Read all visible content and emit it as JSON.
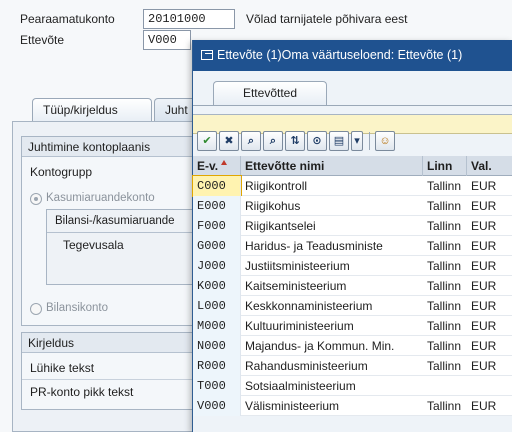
{
  "background": {
    "fields": [
      {
        "label": "Pearaamatukonto",
        "value": "20101000",
        "description": "Võlad tarnijatele põhivara eest"
      },
      {
        "label": "Ettevõte",
        "value": "V000"
      }
    ],
    "tabs": [
      {
        "label": "Tüüp/kirjeldus"
      },
      {
        "label": "Juht"
      }
    ],
    "group_control": {
      "title": "Juhtimine kontoplaanis",
      "kontogrupp_label": "Kontogrupp",
      "radio_income": "Kasumiaruandekonto",
      "inner_title": "Bilansi-/kasumiaruande",
      "tegevusala_label": "Tegevusala",
      "radio_balance": "Bilansikonto"
    },
    "group_description": {
      "title": "Kirjeldus",
      "short_label": "Lühike tekst",
      "long_label": "PR-konto pikk tekst"
    }
  },
  "dialog": {
    "title": "Ettevõte (1)Oma väärtuseloend: Ettevõte (1)",
    "tab": "Ettevõtted",
    "toolbar": [
      {
        "icon": "check-icon",
        "glyph": "✔"
      },
      {
        "icon": "cancel-icon",
        "glyph": "✖"
      },
      {
        "icon": "find-icon",
        "glyph": "⌕"
      },
      {
        "icon": "find-next-icon",
        "glyph": "⌕"
      },
      {
        "icon": "sort-icon",
        "glyph": "⇅"
      },
      {
        "icon": "filter-icon",
        "glyph": "⊙"
      },
      {
        "icon": "print-icon",
        "glyph": "▤"
      },
      {
        "icon": "dropdown-icon",
        "glyph": "▾"
      },
      {
        "icon": "person-icon",
        "glyph": "☺"
      }
    ],
    "columns": [
      "E-v.",
      "Ettevõtte nimi",
      "Linn",
      "Val."
    ],
    "rows": [
      {
        "code": "C000",
        "name": "Riigikontroll",
        "city": "Tallinn",
        "cur": "EUR"
      },
      {
        "code": "E000",
        "name": "Riigikohus",
        "city": "Tallinn",
        "cur": "EUR"
      },
      {
        "code": "F000",
        "name": "Riigikantselei",
        "city": "Tallinn",
        "cur": "EUR"
      },
      {
        "code": "G000",
        "name": "Haridus- ja Teadusministe",
        "city": "Tallinn",
        "cur": "EUR"
      },
      {
        "code": "J000",
        "name": "Justiitsministeerium",
        "city": "Tallinn",
        "cur": "EUR"
      },
      {
        "code": "K000",
        "name": "Kaitseministeerium",
        "city": "Tallinn",
        "cur": "EUR"
      },
      {
        "code": "L000",
        "name": "Keskkonnaministeerium",
        "city": "Tallinn",
        "cur": "EUR"
      },
      {
        "code": "M000",
        "name": "Kultuuriministeerium",
        "city": "Tallinn",
        "cur": "EUR"
      },
      {
        "code": "N000",
        "name": "Majandus- ja Kommun. Min.",
        "city": "Tallinn",
        "cur": "EUR"
      },
      {
        "code": "R000",
        "name": "Rahandusministeerium",
        "city": "Tallinn",
        "cur": "EUR"
      },
      {
        "code": "T000",
        "name": "Sotsiaalministeerium",
        "city": "",
        "cur": ""
      },
      {
        "code": "V000",
        "name": "Välisministeerium",
        "city": "Tallinn",
        "cur": "EUR"
      }
    ]
  }
}
